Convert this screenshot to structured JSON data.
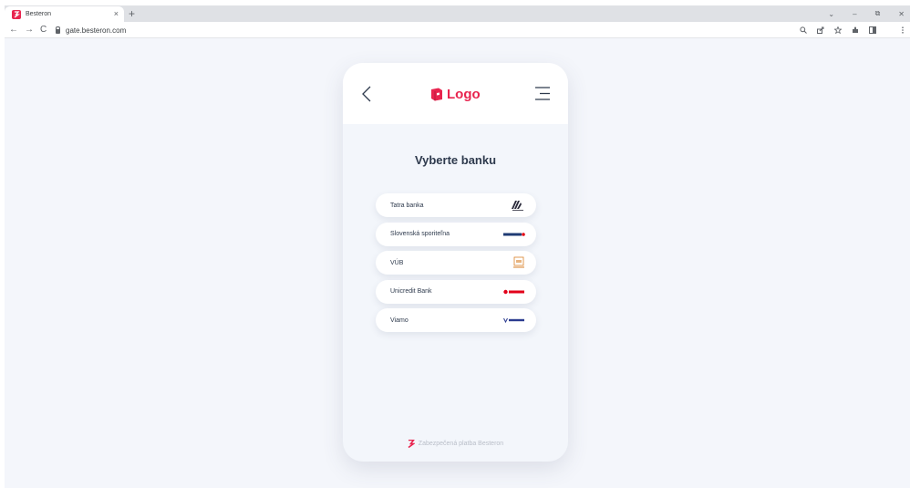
{
  "browser": {
    "tab_title": "Besteron",
    "tab_close": "×",
    "new_tab": "+",
    "url": "gate.besteron.com",
    "nav": {
      "back": "←",
      "forward": "→",
      "reload": "C"
    },
    "window_controls": [
      "⌄",
      "–",
      "⧉",
      "✕"
    ],
    "toolbar_icons": [
      "zoom-icon",
      "share-icon",
      "star-icon",
      "extensions-icon",
      "sidepanel-icon",
      "more-icon"
    ]
  },
  "header": {
    "logo_text": "Logo"
  },
  "main": {
    "heading": "Vyberte banku",
    "banks": [
      {
        "name": "Tatra banka",
        "logo": "tatra-banka-logo"
      },
      {
        "name": "Slovenská sporiteľna",
        "logo": "slovenska-sporitelna-logo"
      },
      {
        "name": "VÚB",
        "logo": "vub-logo"
      },
      {
        "name": "Unicredit Bank",
        "logo": "unicredit-logo"
      },
      {
        "name": "Viamo",
        "logo": "viamo-logo"
      }
    ]
  },
  "footer": {
    "text": "Zabezpečená platba Besteron"
  },
  "colors": {
    "accent": "#e8254f",
    "text": "#2e3a4d",
    "page_bg": "#f4f6fb"
  }
}
